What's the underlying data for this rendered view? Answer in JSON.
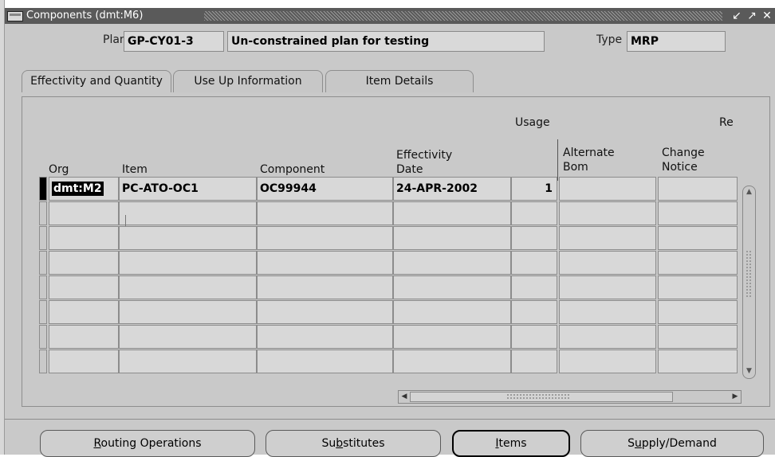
{
  "window": {
    "title": "Components (dmt:M6)",
    "icon": "oracle-app-icon",
    "controls": [
      "minimize-icon",
      "maximize-icon",
      "close-icon"
    ]
  },
  "header": {
    "plan_label": "Plan",
    "plan_value": "GP-CY01-3",
    "plan_description": "Un-constrained plan for testing",
    "type_label": "Type",
    "type_value": "MRP"
  },
  "tabs": [
    {
      "label": "Effectivity and Quantity",
      "active": true
    },
    {
      "label": "Use Up Information",
      "active": false
    },
    {
      "label": "Item Details",
      "active": false
    }
  ],
  "table": {
    "group_headers": {
      "usage": "Usage",
      "re": "Re"
    },
    "columns": {
      "org": "Org",
      "item": "Item",
      "component": "Component",
      "effectivity_line1": "Effectivity",
      "effectivity_line2": "Date",
      "alternate_line1": "Alternate",
      "alternate_line2": "Bom",
      "change_line1": "Change",
      "change_line2": "Notice"
    },
    "rows": [
      {
        "org": "dmt:M2",
        "item": "PC-ATO-OC1",
        "component": "OC99944",
        "effectivity_date": "24-APR-2002",
        "usage": "1",
        "alternate_bom": "",
        "change_notice": ""
      },
      {
        "org": "",
        "item": "",
        "component": "",
        "effectivity_date": "",
        "usage": "",
        "alternate_bom": "",
        "change_notice": ""
      },
      {
        "org": "",
        "item": "",
        "component": "",
        "effectivity_date": "",
        "usage": "",
        "alternate_bom": "",
        "change_notice": ""
      },
      {
        "org": "",
        "item": "",
        "component": "",
        "effectivity_date": "",
        "usage": "",
        "alternate_bom": "",
        "change_notice": ""
      },
      {
        "org": "",
        "item": "",
        "component": "",
        "effectivity_date": "",
        "usage": "",
        "alternate_bom": "",
        "change_notice": ""
      },
      {
        "org": "",
        "item": "",
        "component": "",
        "effectivity_date": "",
        "usage": "",
        "alternate_bom": "",
        "change_notice": ""
      },
      {
        "org": "",
        "item": "",
        "component": "",
        "effectivity_date": "",
        "usage": "",
        "alternate_bom": "",
        "change_notice": ""
      },
      {
        "org": "",
        "item": "",
        "component": "",
        "effectivity_date": "",
        "usage": "",
        "alternate_bom": "",
        "change_notice": ""
      }
    ]
  },
  "buttons": {
    "routing": {
      "pre": "",
      "key": "R",
      "post": "outing Operations"
    },
    "substitutes": {
      "pre": "Su",
      "key": "b",
      "post": "stitutes"
    },
    "items": {
      "pre": "",
      "key": "I",
      "post": "tems"
    },
    "supply": {
      "pre": "S",
      "key": "u",
      "post": "pply/Demand"
    }
  }
}
